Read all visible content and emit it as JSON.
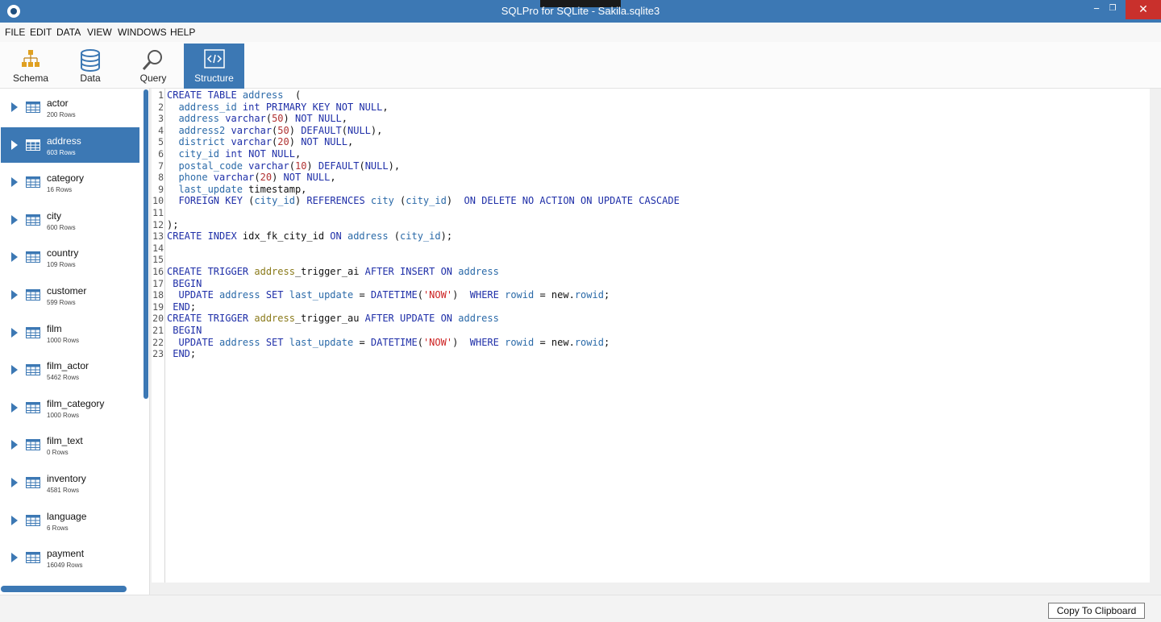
{
  "window": {
    "title": "SQLPro for SQLite - Sakila.sqlite3",
    "minimize": "−",
    "maximize": "❐",
    "close": "✕"
  },
  "menu": [
    "FILE",
    "EDIT",
    "DATA",
    "VIEW",
    "WINDOWS",
    "HELP"
  ],
  "toolbar": [
    {
      "label": "Schema",
      "icon": "schema-icon",
      "active": false
    },
    {
      "label": "Data",
      "icon": "database-icon",
      "active": false
    },
    {
      "label": "Query",
      "icon": "magnifier-icon",
      "active": false
    },
    {
      "label": "Structure",
      "icon": "code-icon",
      "active": true
    }
  ],
  "tables": [
    {
      "name": "actor",
      "rows": "200 Rows"
    },
    {
      "name": "address",
      "rows": "603 Rows",
      "selected": true
    },
    {
      "name": "category",
      "rows": "16 Rows"
    },
    {
      "name": "city",
      "rows": "600 Rows"
    },
    {
      "name": "country",
      "rows": "109 Rows"
    },
    {
      "name": "customer",
      "rows": "599 Rows"
    },
    {
      "name": "film",
      "rows": "1000 Rows"
    },
    {
      "name": "film_actor",
      "rows": "5462 Rows"
    },
    {
      "name": "film_category",
      "rows": "1000 Rows"
    },
    {
      "name": "film_text",
      "rows": "0 Rows"
    },
    {
      "name": "inventory",
      "rows": "4581 Rows"
    },
    {
      "name": "language",
      "rows": "6 Rows"
    },
    {
      "name": "payment",
      "rows": "16049 Rows"
    }
  ],
  "code": [
    [
      [
        "kw",
        "CREATE TABLE "
      ],
      [
        "id",
        "address"
      ],
      [
        "",
        "  ("
      ]
    ],
    [
      [
        "",
        "  "
      ],
      [
        "id",
        "address_id"
      ],
      [
        "ty",
        " int "
      ],
      [
        "kw",
        "PRIMARY KEY NOT NULL"
      ],
      [
        "",
        ","
      ]
    ],
    [
      [
        "",
        "  "
      ],
      [
        "id",
        "address"
      ],
      [
        "ty",
        " varchar"
      ],
      [
        "",
        "("
      ],
      [
        "nm",
        "50"
      ],
      [
        "",
        ") "
      ],
      [
        "kw",
        "NOT NULL"
      ],
      [
        "",
        ","
      ]
    ],
    [
      [
        "",
        "  "
      ],
      [
        "id",
        "address2"
      ],
      [
        "ty",
        " varchar"
      ],
      [
        "",
        "("
      ],
      [
        "nm",
        "50"
      ],
      [
        "",
        ") "
      ],
      [
        "kw",
        "DEFAULT"
      ],
      [
        "",
        "("
      ],
      [
        "kw",
        "NULL"
      ],
      [
        "",
        "),"
      ]
    ],
    [
      [
        "",
        "  "
      ],
      [
        "id",
        "district"
      ],
      [
        "ty",
        " varchar"
      ],
      [
        "",
        "("
      ],
      [
        "nm",
        "20"
      ],
      [
        "",
        ") "
      ],
      [
        "kw",
        "NOT NULL"
      ],
      [
        "",
        ","
      ]
    ],
    [
      [
        "",
        "  "
      ],
      [
        "id",
        "city_id"
      ],
      [
        "ty",
        " int "
      ],
      [
        "kw",
        "NOT NULL"
      ],
      [
        "",
        ","
      ]
    ],
    [
      [
        "",
        "  "
      ],
      [
        "id",
        "postal_code"
      ],
      [
        "ty",
        " varchar"
      ],
      [
        "",
        "("
      ],
      [
        "nm",
        "10"
      ],
      [
        "",
        ") "
      ],
      [
        "kw",
        "DEFAULT"
      ],
      [
        "",
        "("
      ],
      [
        "kw",
        "NULL"
      ],
      [
        "",
        "),"
      ]
    ],
    [
      [
        "",
        "  "
      ],
      [
        "id",
        "phone"
      ],
      [
        "ty",
        " varchar"
      ],
      [
        "",
        "("
      ],
      [
        "nm",
        "20"
      ],
      [
        "",
        ") "
      ],
      [
        "kw",
        "NOT NULL"
      ],
      [
        "",
        ","
      ]
    ],
    [
      [
        "",
        "  "
      ],
      [
        "id",
        "last_update"
      ],
      [
        "",
        ""
      ],
      [
        "",
        ""
      ],
      [
        "",
        ""
      ],
      [
        "",
        ""
      ],
      [
        "",
        ""
      ],
      [
        "",
        ""
      ],
      [
        "",
        ""
      ],
      [
        "",
        ""
      ],
      [
        "",
        ""
      ],
      [
        "",
        ""
      ],
      [
        "",
        ""
      ],
      [
        "",
        ""
      ],
      [
        "",
        ""
      ],
      [
        "",
        ""
      ],
      [
        "",
        ""
      ],
      [
        "",
        ""
      ],
      [
        "",
        ""
      ],
      [
        "",
        ""
      ],
      [
        "",
        ""
      ],
      [
        "",
        ""
      ],
      [
        "",
        ""
      ],
      [
        "",
        ""
      ],
      [
        "",
        ""
      ],
      [
        "",
        ""
      ],
      [
        "",
        ""
      ],
      [
        "",
        ""
      ],
      [
        "",
        ""
      ],
      [
        "",
        ""
      ],
      [
        "",
        ""
      ],
      [
        "",
        ""
      ],
      [
        "",
        ""
      ],
      [
        "",
        ""
      ],
      [
        "",
        ""
      ],
      [
        "",
        ""
      ],
      [
        "",
        ""
      ],
      [
        "",
        ""
      ],
      [
        "",
        ""
      ],
      [
        "",
        ""
      ],
      [
        "",
        ""
      ],
      [
        "",
        ""
      ],
      [
        "",
        ""
      ],
      [
        "",
        ""
      ],
      [
        "",
        ""
      ],
      [
        "",
        ""
      ],
      [
        "",
        ""
      ],
      [
        "",
        ""
      ],
      [
        "",
        ""
      ],
      [
        "",
        ""
      ],
      [
        "",
        ""
      ],
      [
        "",
        ""
      ],
      [
        "",
        ""
      ],
      [
        "",
        ""
      ],
      [
        "",
        ""
      ],
      [
        "",
        ""
      ],
      [
        "",
        ""
      ],
      [
        "",
        ""
      ],
      [
        "",
        ""
      ],
      [
        "",
        ""
      ],
      [
        "",
        ""
      ],
      [
        "",
        ""
      ],
      [
        "",
        ""
      ],
      [
        "",
        ""
      ],
      [
        "",
        ""
      ],
      [
        "",
        ""
      ],
      [
        "",
        ""
      ],
      [
        "",
        ""
      ],
      [
        "",
        ""
      ],
      [
        "",
        ""
      ],
      [
        "",
        ""
      ],
      [
        "",
        ""
      ],
      [
        "",
        ""
      ],
      [
        "",
        ""
      ],
      [
        "",
        ""
      ],
      [
        "",
        ""
      ],
      [
        "",
        ""
      ],
      [
        "",
        ""
      ],
      [
        "",
        ""
      ],
      [
        "",
        ""
      ],
      [
        "",
        ""
      ],
      [
        "",
        ""
      ],
      [
        "",
        ""
      ],
      [
        "",
        ""
      ],
      [
        "",
        ""
      ],
      [
        "",
        ""
      ],
      [
        "",
        ""
      ],
      [
        "",
        ""
      ],
      [
        "",
        ""
      ],
      [
        "",
        ""
      ],
      [
        "",
        ""
      ],
      [
        "",
        ""
      ],
      [
        "",
        ""
      ],
      [
        "",
        ""
      ],
      [
        "",
        ""
      ],
      [
        "",
        ""
      ],
      [
        "",
        " timestamp,"
      ]
    ],
    [
      [
        "",
        "  "
      ],
      [
        "kw",
        "FOREIGN KEY"
      ],
      [
        "",
        " ("
      ],
      [
        "id",
        "city_id"
      ],
      [
        "",
        ") "
      ],
      [
        "kw",
        "REFERENCES"
      ],
      [
        "id",
        " city"
      ],
      [
        "",
        " ("
      ],
      [
        "id",
        "city_id"
      ],
      [
        "",
        ")  "
      ],
      [
        "kw",
        "ON DELETE NO ACTION ON UPDATE CASCADE"
      ]
    ],
    [],
    [
      [
        "",
        ");"
      ]
    ],
    [
      [
        "kw",
        "CREATE INDEX "
      ],
      [
        "",
        "idx_fk_city_id "
      ],
      [
        "kw",
        "ON "
      ],
      [
        "id",
        "address"
      ],
      [
        "",
        " ("
      ],
      [
        "id",
        "city_id"
      ],
      [
        "",
        ");"
      ]
    ],
    [],
    [],
    [
      [
        "kw",
        "CREATE TRIGGER "
      ],
      [
        "tr",
        "address"
      ],
      [
        "",
        "_trigger_ai "
      ],
      [
        "kw",
        "AFTER INSERT ON "
      ],
      [
        "id",
        "address"
      ]
    ],
    [
      [
        "",
        " "
      ],
      [
        "kw",
        "BEGIN"
      ]
    ],
    [
      [
        "",
        "  "
      ],
      [
        "kw",
        "UPDATE "
      ],
      [
        "id",
        "address"
      ],
      [
        "kw",
        " SET "
      ],
      [
        "id",
        "last_update"
      ],
      [
        "",
        " = "
      ],
      [
        "kw",
        "DATETIME"
      ],
      [
        "",
        "("
      ],
      [
        "st",
        "'NOW'"
      ],
      [
        "",
        ")  "
      ],
      [
        "kw",
        "WHERE "
      ],
      [
        "id",
        "rowid"
      ],
      [
        "",
        " = new."
      ],
      [
        "id",
        "rowid"
      ],
      [
        "",
        ";"
      ]
    ],
    [
      [
        "",
        " "
      ],
      [
        "kw",
        "END"
      ],
      [
        "",
        ";"
      ]
    ],
    [
      [
        "kw",
        "CREATE TRIGGER "
      ],
      [
        "tr",
        "address"
      ],
      [
        "",
        "_trigger_au "
      ],
      [
        "kw",
        "AFTER UPDATE ON "
      ],
      [
        "id",
        "address"
      ]
    ],
    [
      [
        "",
        " "
      ],
      [
        "kw",
        "BEGIN"
      ]
    ],
    [
      [
        "",
        "  "
      ],
      [
        "kw",
        "UPDATE "
      ],
      [
        "id",
        "address"
      ],
      [
        "kw",
        " SET "
      ],
      [
        "id",
        "last_update"
      ],
      [
        "",
        " = "
      ],
      [
        "kw",
        "DATETIME"
      ],
      [
        "",
        "("
      ],
      [
        "st",
        "'NOW'"
      ],
      [
        "",
        ")  "
      ],
      [
        "kw",
        "WHERE "
      ],
      [
        "id",
        "rowid"
      ],
      [
        "",
        " = new."
      ],
      [
        "id",
        "rowid"
      ],
      [
        "",
        ";"
      ]
    ],
    [
      [
        "",
        " "
      ],
      [
        "kw",
        "END"
      ],
      [
        "",
        ";"
      ]
    ]
  ],
  "footer": {
    "copy_label": "Copy To Clipboard"
  },
  "colors": {
    "accent": "#3c78b4"
  }
}
